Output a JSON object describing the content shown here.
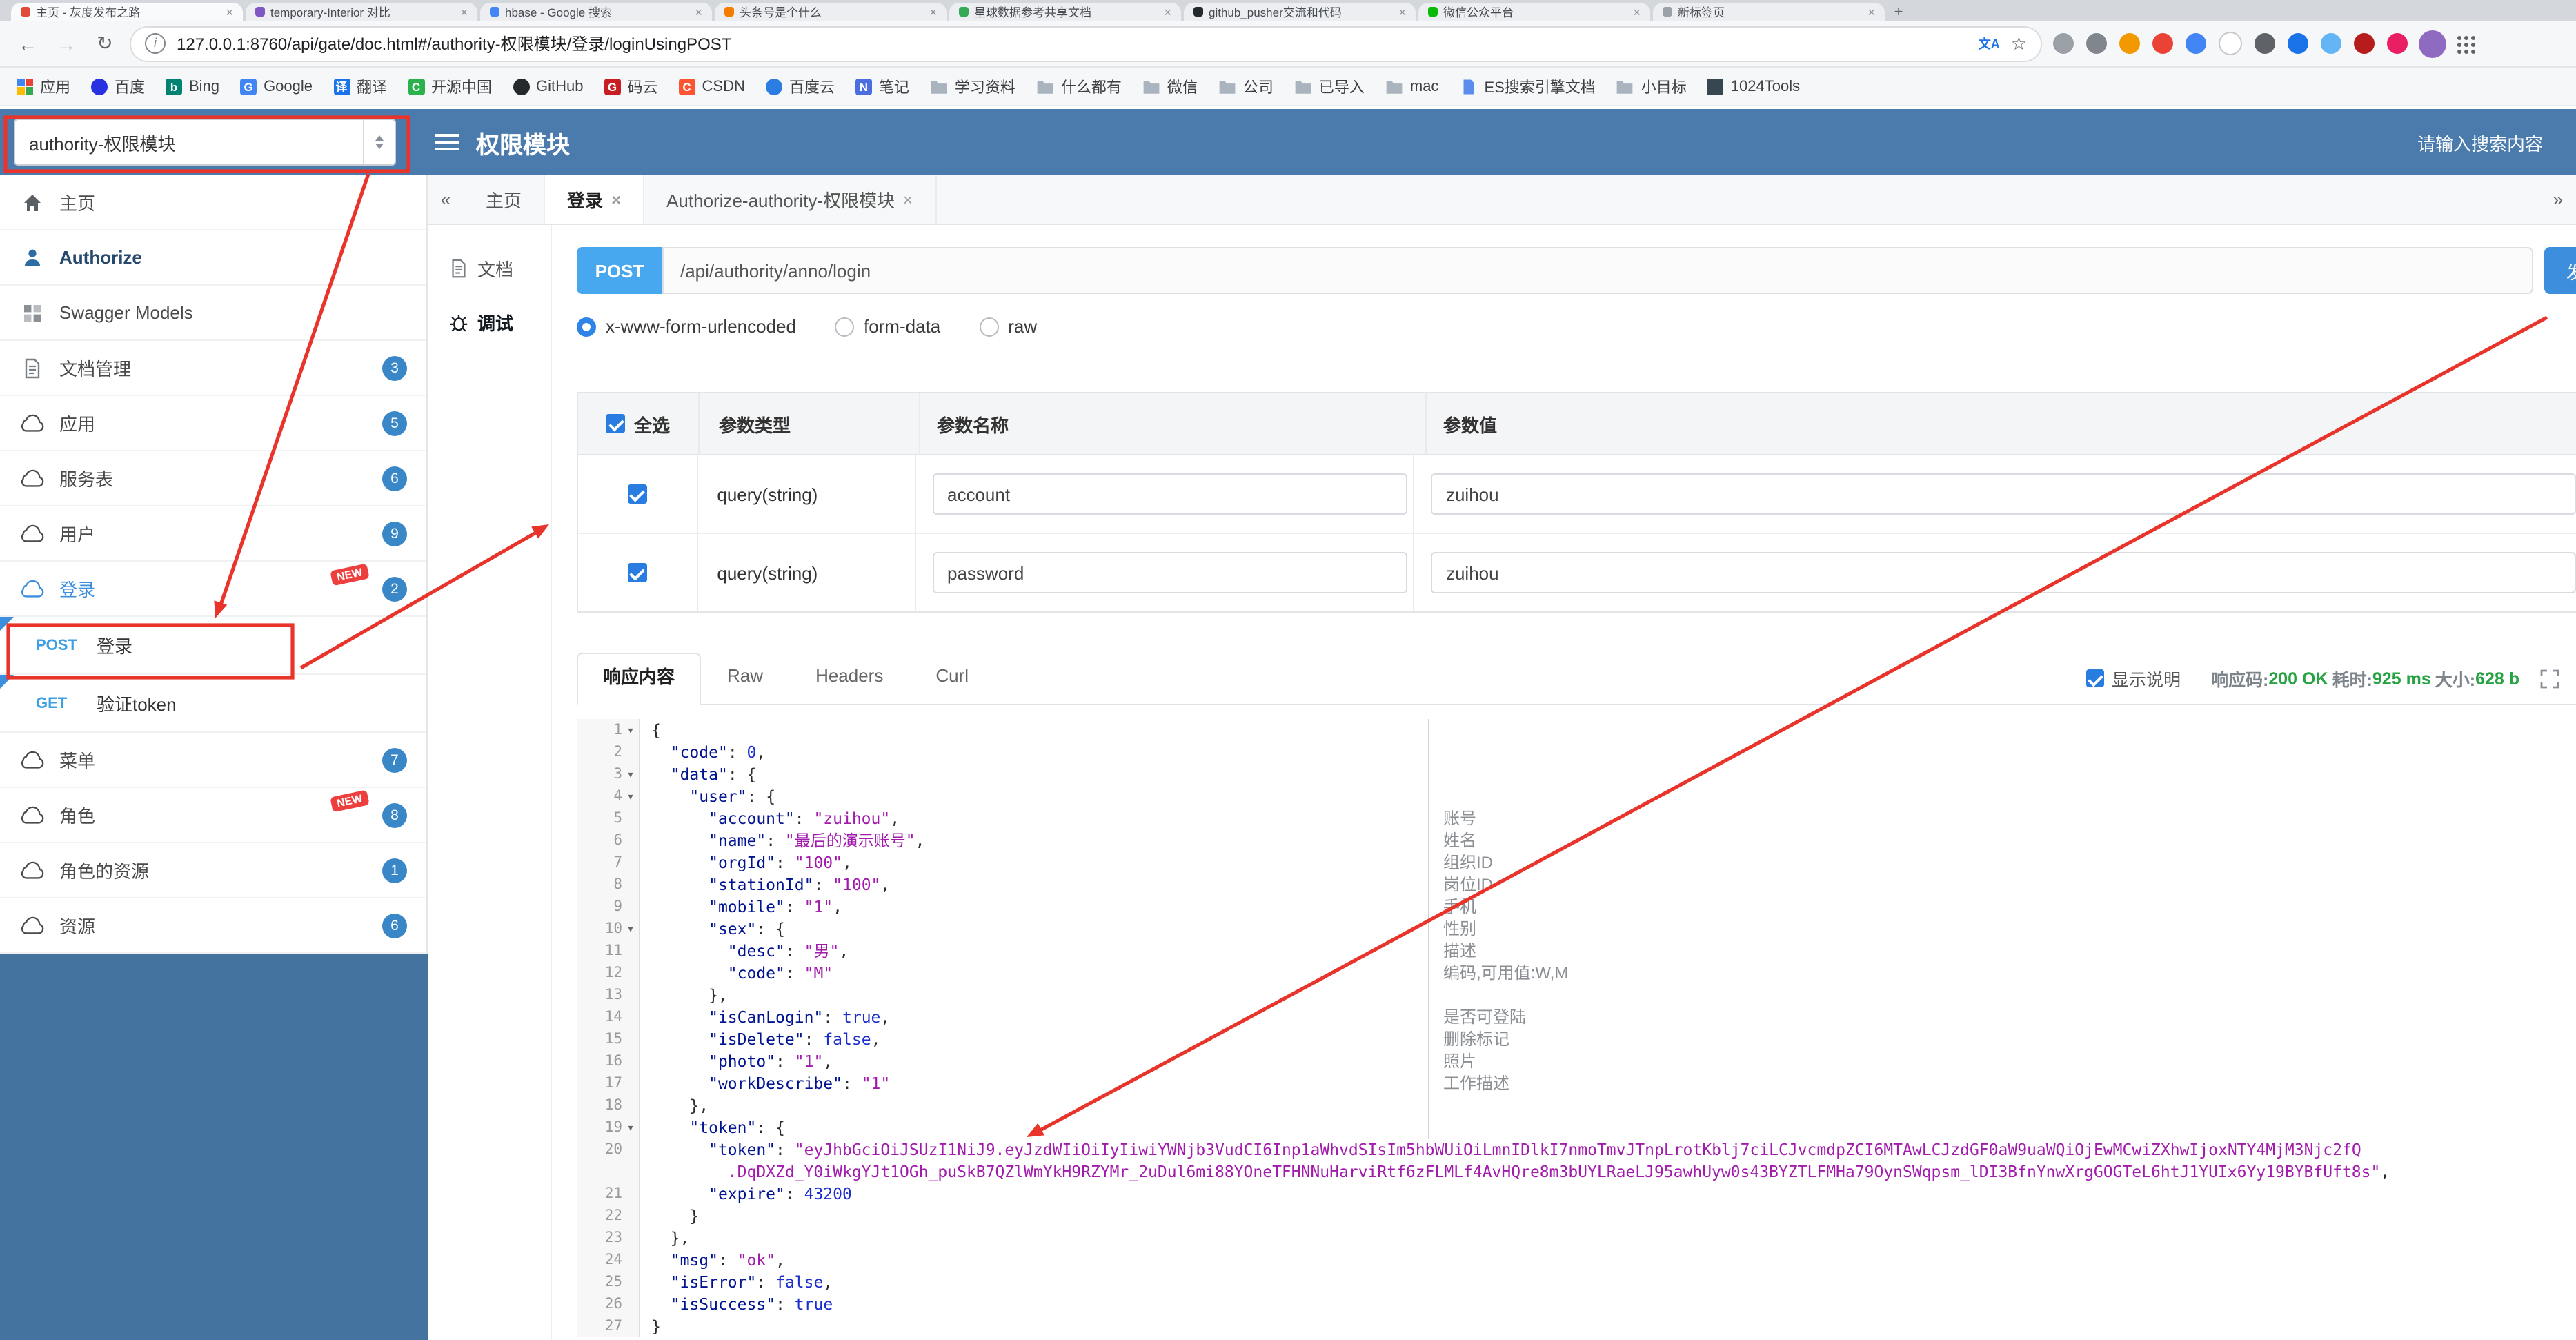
{
  "browser": {
    "tab_strip": [
      {
        "title": "主页 - 灰度发布之路",
        "color": "#e04b3a"
      },
      {
        "title": "temporary-Interior 对比",
        "color": "#7e57c2"
      },
      {
        "title": "hbase - Google 搜索",
        "color": "#4285f4"
      },
      {
        "title": "头条号是个什么",
        "color": "#f57c00"
      },
      {
        "title": "星球数据参考共享文档",
        "color": "#34a853"
      },
      {
        "title": "github_pusher交流和代码",
        "color": "#24292e"
      },
      {
        "title": "微信公众平台",
        "color": "#09bb07"
      },
      {
        "title": "新标签页",
        "color": "#9aa0a6"
      }
    ],
    "url": "127.0.0.1:8760/api/gate/doc.html#/authority-权限模块/登录/loginUsingPOST",
    "extensions": [
      "#9aa0a6",
      "#80868b",
      "#f29900",
      "#ea4335",
      "#4285f4",
      "#ffffff",
      "#5f6368",
      "#1a73e8",
      "#64b5f6",
      "#b71c1c",
      "#e91e63"
    ],
    "bookmarks": [
      {
        "label": "应用",
        "icon": "apps"
      },
      {
        "label": "百度",
        "icon": "dot",
        "color": "#2932e1"
      },
      {
        "label": "Bing",
        "icon": "letter",
        "glyph": "b",
        "color": "#008373"
      },
      {
        "label": "Google",
        "icon": "letter",
        "glyph": "G",
        "color": "#4285f4"
      },
      {
        "label": "翻译",
        "icon": "letter",
        "glyph": "译",
        "color": "#1a73e8"
      },
      {
        "label": "开源中国",
        "icon": "letter",
        "glyph": "C",
        "color": "#2bb24c"
      },
      {
        "label": "GitHub",
        "icon": "dot",
        "color": "#24292e"
      },
      {
        "label": "码云",
        "icon": "letter",
        "glyph": "G",
        "color": "#c71d23"
      },
      {
        "label": "CSDN",
        "icon": "letter",
        "glyph": "C",
        "color": "#fc5531"
      },
      {
        "label": "百度云",
        "icon": "dot",
        "color": "#2b7de1"
      },
      {
        "label": "笔记",
        "icon": "letter",
        "glyph": "N",
        "color": "#4a6ee0"
      },
      {
        "label": "学习资料",
        "icon": "folder"
      },
      {
        "label": "什么都有",
        "icon": "folder"
      },
      {
        "label": "微信",
        "icon": "folder"
      },
      {
        "label": "公司",
        "icon": "folder"
      },
      {
        "label": "已导入",
        "icon": "folder"
      },
      {
        "label": "mac",
        "icon": "folder"
      },
      {
        "label": "ES搜索引擎文档",
        "icon": "docfile",
        "color": "#5b8def"
      },
      {
        "label": "小目标",
        "icon": "folder"
      },
      {
        "label": "1024Tools",
        "icon": "grid",
        "color": "#37474f"
      }
    ]
  },
  "app_header": {
    "group_select": "authority-权限模块",
    "title": "权限模块",
    "search_placeholder": "请输入搜索内容"
  },
  "sidebar": {
    "items": [
      {
        "label": "主页",
        "icon": "home"
      },
      {
        "label": "Authorize",
        "icon": "authorize"
      },
      {
        "label": "Swagger Models",
        "icon": "models"
      },
      {
        "label": "文档管理",
        "icon": "doc",
        "badge": "3"
      },
      {
        "label": "应用",
        "icon": "cloud",
        "badge": "5"
      },
      {
        "label": "服务表",
        "icon": "cloud",
        "badge": "6"
      },
      {
        "label": "用户",
        "icon": "cloud",
        "badge": "9"
      },
      {
        "label": "登录",
        "icon": "cloud",
        "badge": "2",
        "new": true,
        "active": true
      },
      {
        "method": "POST",
        "label": "登录"
      },
      {
        "method": "GET",
        "label": "验证token"
      },
      {
        "label": "菜单",
        "icon": "cloud",
        "badge": "7"
      },
      {
        "label": "角色",
        "icon": "cloud",
        "badge": "8",
        "new": true
      },
      {
        "label": "角色的资源",
        "icon": "cloud",
        "badge": "1"
      },
      {
        "label": "资源",
        "icon": "cloud",
        "badge": "6"
      }
    ]
  },
  "doc_tabs": {
    "left_chevron": "«",
    "right_chevron": "»",
    "tabs": [
      {
        "label": "主页",
        "closable": false,
        "active": false
      },
      {
        "label": "登录",
        "closable": true,
        "active": true
      },
      {
        "label": "Authorize-authority-权限模块",
        "closable": true,
        "active": false
      }
    ]
  },
  "panel_tabs": [
    {
      "label": "文档",
      "icon": "doc",
      "active": false
    },
    {
      "label": "调试",
      "icon": "bug",
      "active": true
    }
  ],
  "debug": {
    "method": "POST",
    "url": "/api/authority/anno/login",
    "send_label": "发送",
    "content_types": [
      "x-www-form-urlencoded",
      "form-data",
      "raw"
    ],
    "selected_content_type": "x-www-form-urlencoded",
    "param_table": {
      "headers": [
        "全选",
        "参数类型",
        "参数名称",
        "参数值"
      ],
      "rows": [
        {
          "checked": true,
          "type": "query(string)",
          "name": "account",
          "value": "zuihou"
        },
        {
          "checked": true,
          "type": "query(string)",
          "name": "password",
          "value": "zuihou"
        }
      ]
    }
  },
  "response": {
    "tabs": [
      {
        "label": "响应内容",
        "active": true
      },
      {
        "label": "Raw",
        "active": false
      },
      {
        "label": "Headers",
        "active": false
      },
      {
        "label": "Curl",
        "active": false
      }
    ],
    "show_desc": "显示说明",
    "meta": [
      {
        "label": "响应码:",
        "value": "200 OK"
      },
      {
        "label": "耗时:",
        "value": "925 ms"
      },
      {
        "label": "大小:",
        "value": "628 b"
      }
    ]
  },
  "code": {
    "lines": [
      {
        "n": 1,
        "fold": true,
        "t": "{"
      },
      {
        "n": 2,
        "t": "  \"code\": 0,"
      },
      {
        "n": 3,
        "fold": true,
        "t": "  \"data\": {"
      },
      {
        "n": 4,
        "fold": true,
        "t": "    \"user\": {"
      },
      {
        "n": 5,
        "t": "      \"account\": \"zuihou\","
      },
      {
        "n": 6,
        "t": "      \"name\": \"最后的演示账号\","
      },
      {
        "n": 7,
        "t": "      \"orgId\": \"100\","
      },
      {
        "n": 8,
        "t": "      \"stationId\": \"100\","
      },
      {
        "n": 9,
        "t": "      \"mobile\": \"1\","
      },
      {
        "n": 10,
        "fold": true,
        "t": "      \"sex\": {"
      },
      {
        "n": 11,
        "t": "        \"desc\": \"男\","
      },
      {
        "n": 12,
        "t": "        \"code\": \"M\""
      },
      {
        "n": 13,
        "t": "      },"
      },
      {
        "n": 14,
        "t": "      \"isCanLogin\": true,"
      },
      {
        "n": 15,
        "t": "      \"isDelete\": false,"
      },
      {
        "n": 16,
        "t": "      \"photo\": \"1\","
      },
      {
        "n": 17,
        "t": "      \"workDescribe\": \"1\""
      },
      {
        "n": 18,
        "t": "    },"
      },
      {
        "n": 19,
        "fold": true,
        "t": "    \"token\": {"
      },
      {
        "n": 20,
        "t": "      \"token\": \"eyJhbGciOiJSUzI1NiJ9.eyJzdWIiOiIyIiwiYWNjb3VudCI6Inp1aWhvdSIsIm5hbWUiOiLmnIDlkI7nmoTmvJTnpLrotKblj7ciLCJvcmdpZCI6MTAwLCJzdGF0aW9uaWQiOjEwMCwiZXhwIjoxNTY4MjM3Njc2fQ",
        "wrap": "        .DqDXZd_Y0iWkgYJt1OGh_puSkB7QZlWmYkH9RZYMr_2uDul6mi88YOneTFHNNuHarviRtf6zFLMLf4AvHQre8m3bUYLRaeLJ95awhUyw0s43BYZTLFMHa79OynSWqpsm_lDI3BfnYnwXrgGOGTeL6htJ1YUIx6Yy19BYBfUft8s\","
      },
      {
        "n": 21,
        "t": "      \"expire\": 43200"
      },
      {
        "n": 22,
        "t": "    }"
      },
      {
        "n": 23,
        "t": "  },"
      },
      {
        "n": 24,
        "t": "  \"msg\": \"ok\","
      },
      {
        "n": 25,
        "t": "  \"isError\": false,"
      },
      {
        "n": 26,
        "t": "  \"isSuccess\": true"
      },
      {
        "n": 27,
        "t": "}"
      }
    ],
    "comments": {
      "5": "账号",
      "6": "姓名",
      "7": "组织ID",
      "8": "岗位ID",
      "9": "手机",
      "10": "性别",
      "11": "描述",
      "12": "编码,可用值:W,M",
      "14": "是否可登陆",
      "15": "删除标记",
      "16": "照片",
      "17": "工作描述"
    }
  }
}
